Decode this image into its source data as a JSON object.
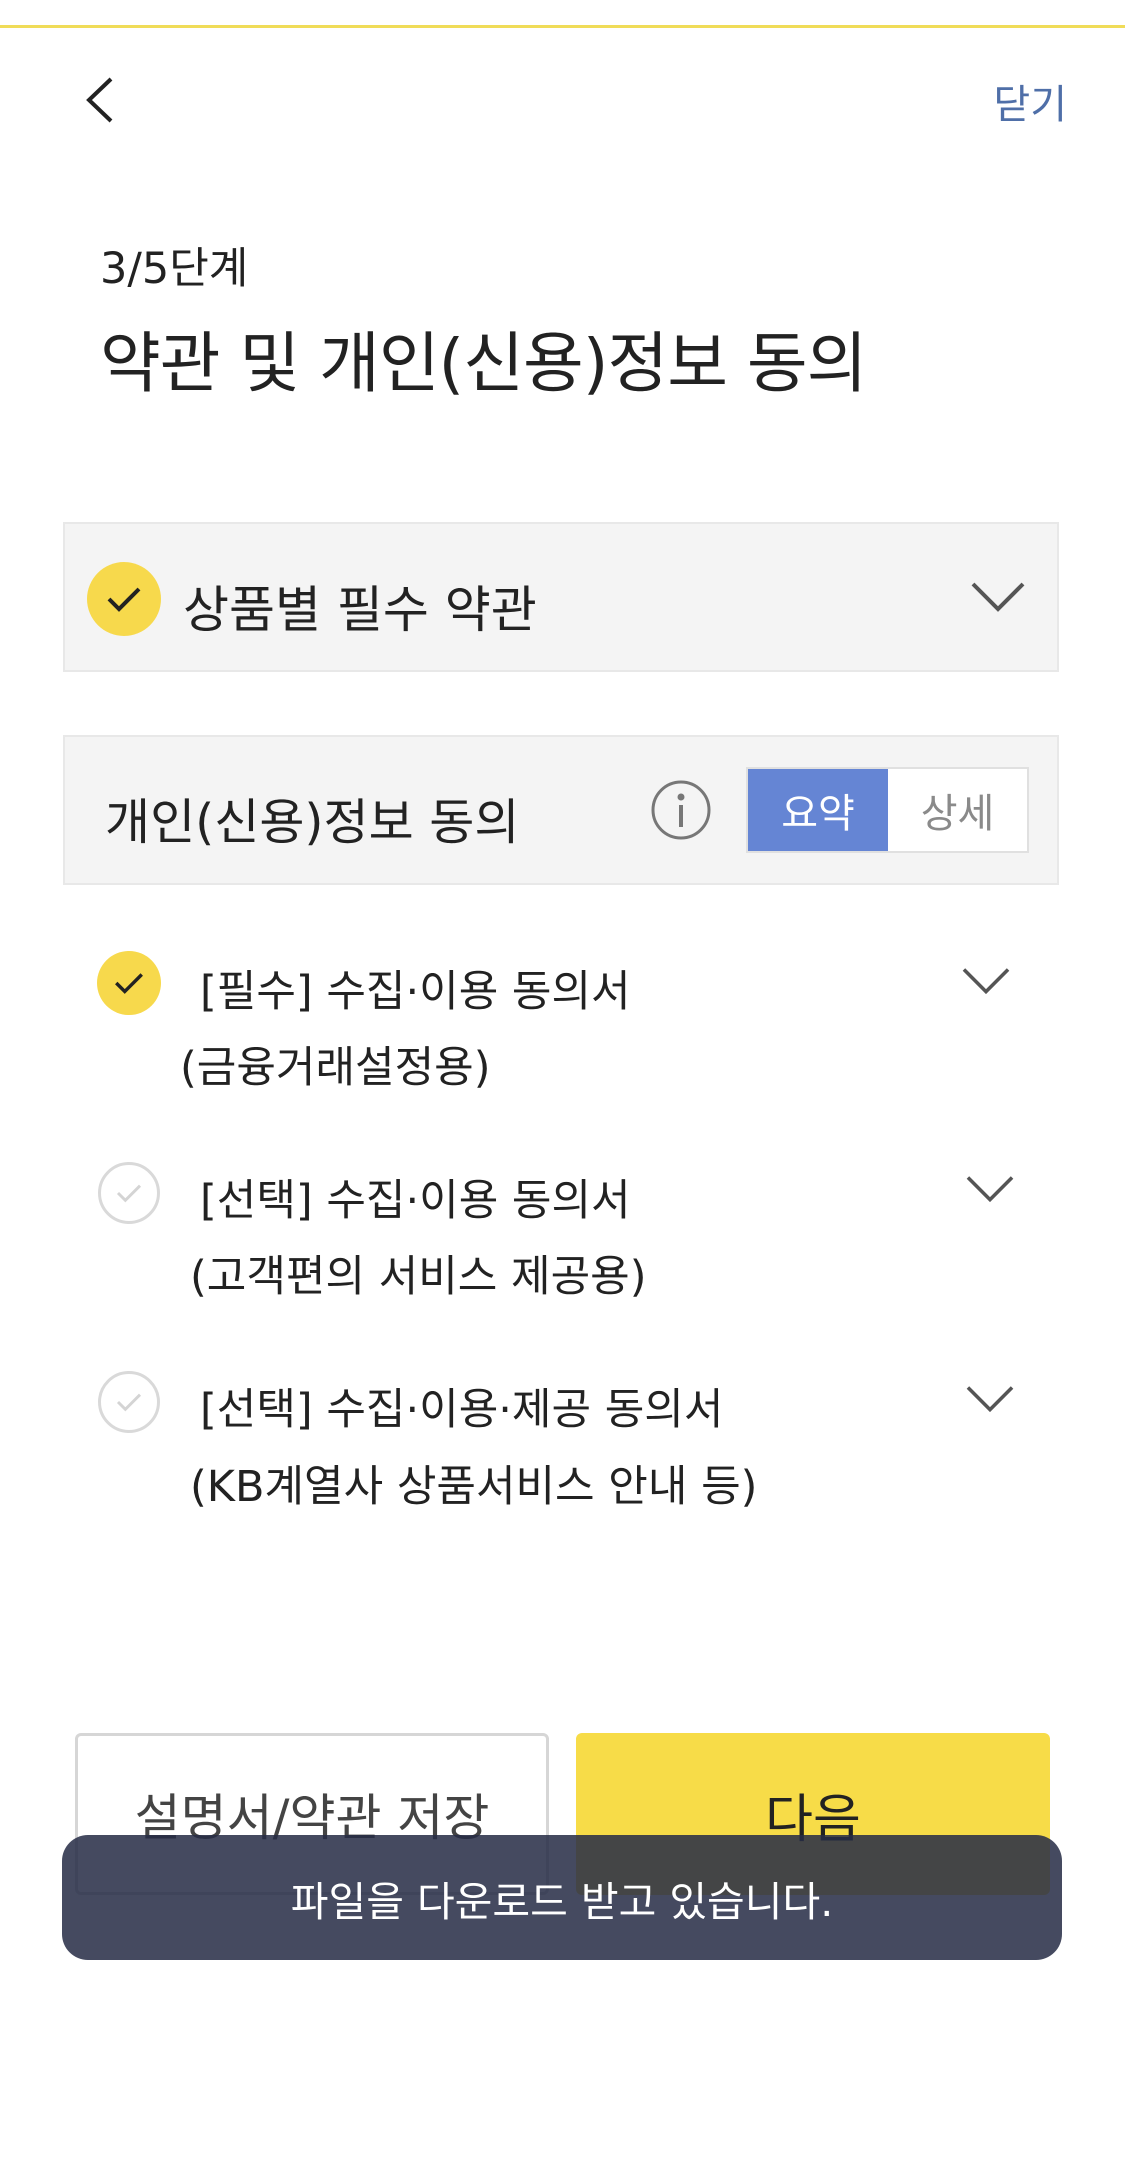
{
  "header": {
    "back_icon": "chevron-left-icon",
    "close_label": "닫기"
  },
  "step": {
    "label": "3/5단계",
    "title": "약관 및 개인(신용)정보 동의"
  },
  "section_required_terms": {
    "label": "상품별 필수 약관",
    "checked": true
  },
  "section_personal_info": {
    "label": "개인(신용)정보 동의",
    "info_icon": "info-icon",
    "toggle": {
      "summary": "요약",
      "detail": "상세",
      "selected": "요약"
    }
  },
  "terms": [
    {
      "line1": "[필수] 수집·이용 동의서",
      "line2": "(금융거래설정용)",
      "checked": true
    },
    {
      "line1": "[선택] 수집·이용 동의서",
      "line2": "(고객편의 서비스 제공용)",
      "checked": false
    },
    {
      "line1": "[선택] 수집·이용·제공 동의서",
      "line2": "(KB계열사 상품서비스 안내 등)",
      "checked": false
    }
  ],
  "buttons": {
    "save_label": "설명서/약관 저장",
    "next_label": "다음"
  },
  "toast": {
    "message": "파일을 다운로드 받고 있습니다."
  },
  "colors": {
    "accent_yellow": "#f7d94c",
    "toggle_blue": "#6585d4",
    "link_blue": "#4f6fa8",
    "toast_bg": "#262c46"
  }
}
